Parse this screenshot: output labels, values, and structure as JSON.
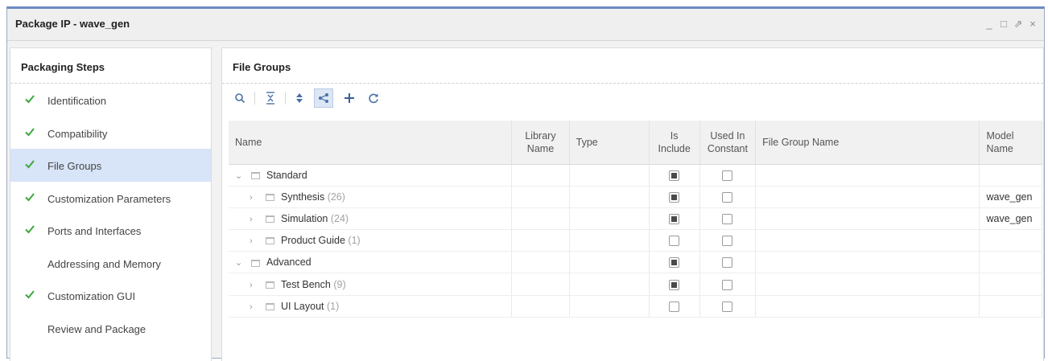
{
  "window": {
    "title": "Package IP - wave_gen",
    "controls": [
      "_",
      "□",
      "⇗",
      "×"
    ]
  },
  "steps_panel": {
    "title": "Packaging Steps",
    "items": [
      {
        "label": "Identification",
        "done": true,
        "active": false
      },
      {
        "label": "Compatibility",
        "done": true,
        "active": false
      },
      {
        "label": "File Groups",
        "done": true,
        "active": true
      },
      {
        "label": "Customization Parameters",
        "done": true,
        "active": false
      },
      {
        "label": "Ports and Interfaces",
        "done": true,
        "active": false
      },
      {
        "label": "Addressing and Memory",
        "done": false,
        "active": false
      },
      {
        "label": "Customization GUI",
        "done": true,
        "active": false
      },
      {
        "label": "Review and Package",
        "done": false,
        "active": false
      }
    ]
  },
  "file_groups": {
    "title": "File Groups",
    "toolbar": [
      "search-icon",
      "collapse-all-icon",
      "expand-all-icon",
      "hierarchy-icon",
      "add-icon",
      "refresh-icon"
    ],
    "columns": {
      "name": "Name",
      "library": [
        "Library",
        "Name"
      ],
      "type": "Type",
      "include": [
        "Is",
        "Include"
      ],
      "constant": [
        "Used In",
        "Constant"
      ],
      "group": "File Group Name",
      "model": [
        "Model",
        "Name"
      ]
    },
    "rows": [
      {
        "level": 0,
        "expanded": true,
        "name": "Standard",
        "count": "",
        "include": true,
        "constant": false,
        "model": ""
      },
      {
        "level": 1,
        "expanded": false,
        "name": "Synthesis",
        "count": "(26)",
        "include": true,
        "constant": false,
        "model": "wave_gen"
      },
      {
        "level": 1,
        "expanded": false,
        "name": "Simulation",
        "count": "(24)",
        "include": true,
        "constant": false,
        "model": "wave_gen"
      },
      {
        "level": 1,
        "expanded": false,
        "name": "Product Guide",
        "count": "(1)",
        "include": false,
        "constant": false,
        "model": ""
      },
      {
        "level": 0,
        "expanded": true,
        "name": "Advanced",
        "count": "",
        "include": true,
        "constant": false,
        "model": ""
      },
      {
        "level": 1,
        "expanded": false,
        "name": "Test Bench",
        "count": "(9)",
        "include": true,
        "constant": false,
        "model": ""
      },
      {
        "level": 1,
        "expanded": false,
        "name": "UI Layout",
        "count": "(1)",
        "include": false,
        "constant": false,
        "model": ""
      }
    ]
  },
  "colors": {
    "accent": "#6f8ac0",
    "check": "#3da73d",
    "selection": "#d8e4f7"
  }
}
